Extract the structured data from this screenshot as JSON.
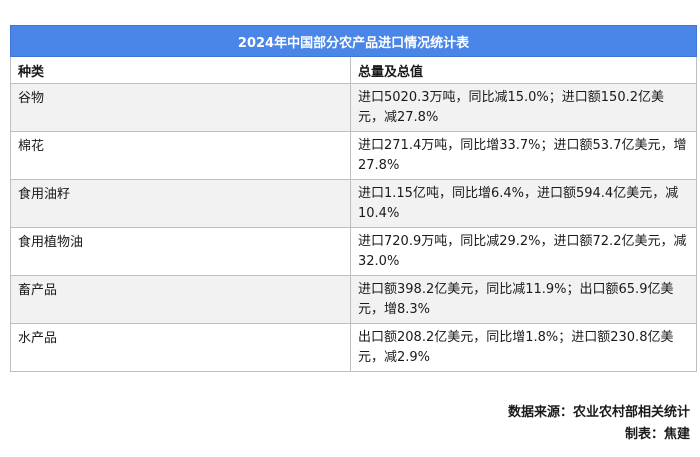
{
  "table": {
    "title": "2024年中国部分农产品进口情况统计表",
    "headers": [
      "种类",
      "总量及总值"
    ],
    "rows": [
      {
        "category": "谷物",
        "detail": "进口5020.3万吨，同比减15.0%；进口额150.2亿美元，减27.8%"
      },
      {
        "category": "棉花",
        "detail": "进口271.4万吨，同比增33.7%；进口额53.7亿美元，增27.8%"
      },
      {
        "category": "食用油籽",
        "detail": "进口1.15亿吨，同比增6.4%，进口额594.4亿美元，减10.4%"
      },
      {
        "category": "食用植物油",
        "detail": "进口720.9万吨，同比减29.2%，进口额72.2亿美元，减32.0%"
      },
      {
        "category": "畜产品",
        "detail": "进口额398.2亿美元，同比减11.9%；出口额65.9亿美元，增8.3%"
      },
      {
        "category": "水产品",
        "detail": "出口额208.2亿美元，同比增1.8%；进口额230.8亿美元，减2.9%"
      }
    ]
  },
  "footer": {
    "source": "数据来源：农业农村部相关统计",
    "maker": "制表：焦建"
  },
  "colors": {
    "header_bg": "#4a86e8",
    "alt_row_bg": "#f2f2f2"
  }
}
